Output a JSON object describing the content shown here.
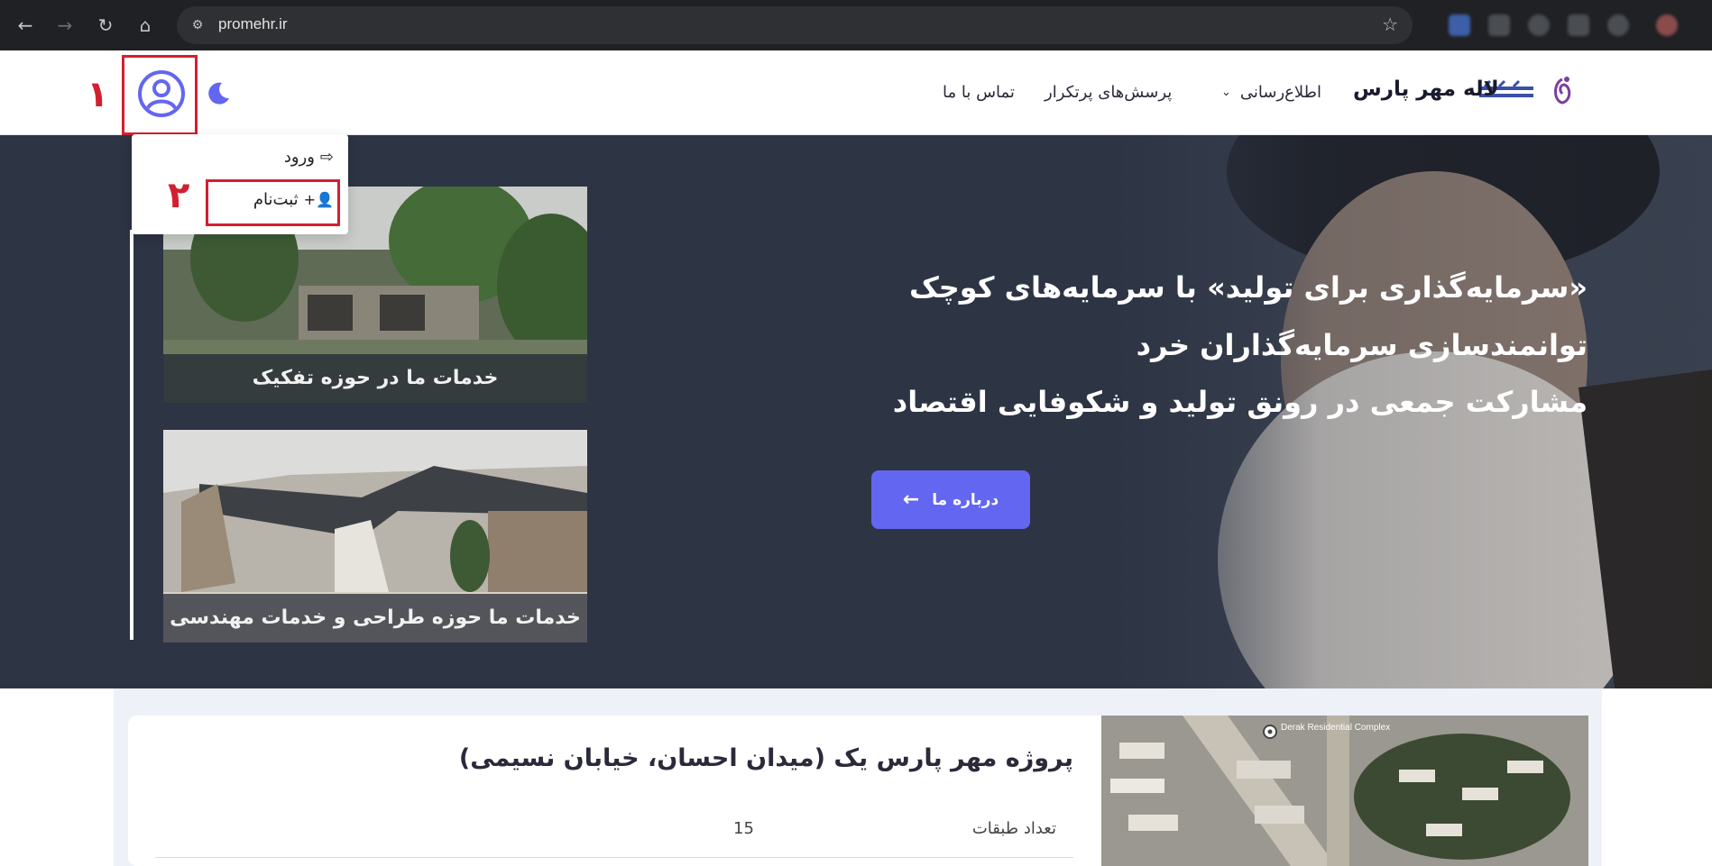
{
  "browser": {
    "url": "promehr.ir",
    "nav_icons": [
      "back-icon",
      "forward-icon",
      "reload-icon",
      "home-icon"
    ]
  },
  "header": {
    "brand": "لاله مهر پارس",
    "nav": [
      "اطلاع‌رسانی",
      "پرسش‌های پرتکرار",
      "تماس با ما"
    ],
    "accent_color": "#6366f1"
  },
  "user_menu": {
    "login_label": "ورود",
    "signup_label": "ثبت‌نام"
  },
  "annotations": {
    "marker_1": "۱",
    "marker_2": "۲"
  },
  "hero": {
    "lines": [
      "«سرمایه‌گذاری برای تولید» با سرمایه‌های کوچک",
      "توانمندسازی سرمایه‌گذاران خرد",
      "مشارکت جمعی در رونق تولید و شکوفایی اقتصاد"
    ],
    "about_button": "درباره ما",
    "cards": [
      {
        "caption": "خدمات ما در حوزه تفکیک"
      },
      {
        "caption": "خدمات ما حوزه طراحی و خدمات مهندسی"
      }
    ]
  },
  "project": {
    "title": "پروژه مهر پارس یک (میدان احسان، خیابان نسیمی)",
    "floors_label": "تعداد طبقات",
    "floors_value": "15",
    "map_label": "Derak Residential Complex"
  }
}
